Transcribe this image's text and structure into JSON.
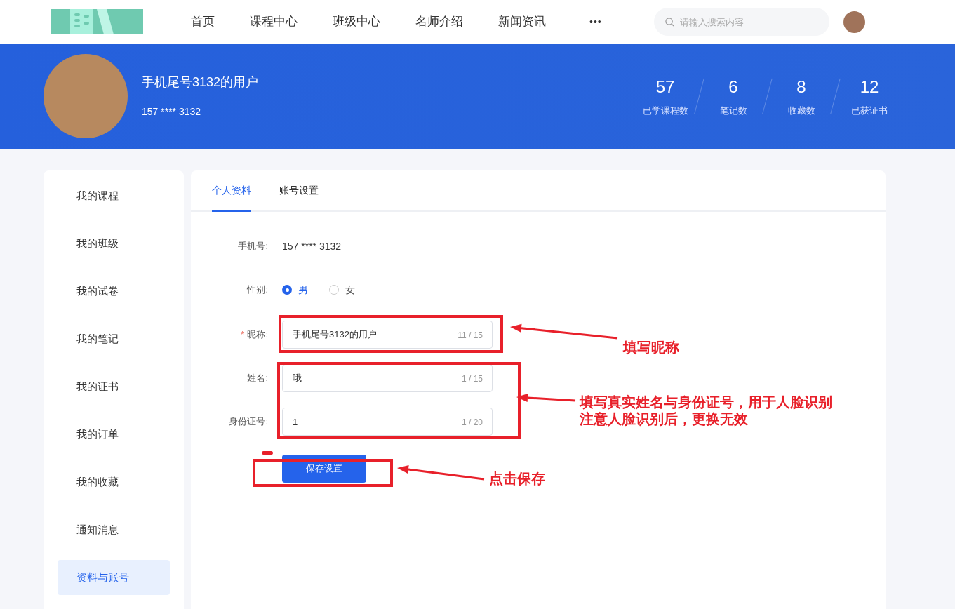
{
  "nav": {
    "items": [
      {
        "label": "首页",
        "selected": false
      },
      {
        "label": "课程中心",
        "selected": false
      },
      {
        "label": "班级中心",
        "selected": false
      },
      {
        "label": "名师介绍",
        "selected": false
      },
      {
        "label": "新闻资讯",
        "selected": false
      }
    ],
    "more": "•••",
    "search": {
      "placeholder": "请输入搜索内容"
    }
  },
  "profile": {
    "name": "手机尾号3132的用户",
    "phone": "157 **** 3132",
    "stats": [
      {
        "value": "57",
        "label": "已学课程数"
      },
      {
        "value": "6",
        "label": "笔记数"
      },
      {
        "value": "8",
        "label": "收藏数"
      },
      {
        "value": "12",
        "label": "已获证书"
      }
    ]
  },
  "sidebar": {
    "items": [
      {
        "label": "我的课程",
        "selected": false
      },
      {
        "label": "我的班级",
        "selected": false
      },
      {
        "label": "我的试卷",
        "selected": false
      },
      {
        "label": "我的笔记",
        "selected": false
      },
      {
        "label": "我的证书",
        "selected": false
      },
      {
        "label": "我的订单",
        "selected": false
      },
      {
        "label": "我的收藏",
        "selected": false
      },
      {
        "label": "通知消息",
        "selected": false
      },
      {
        "label": "资料与账号",
        "selected": true
      }
    ]
  },
  "tabs": [
    {
      "label": "个人资料",
      "selected": true
    },
    {
      "label": "账号设置",
      "selected": false
    }
  ],
  "form": {
    "phone_label": "手机号:",
    "phone": "157 **** 3132",
    "gender_label": "性别:",
    "genders": [
      {
        "label": "男",
        "selected": true
      },
      {
        "label": "女",
        "selected": false
      }
    ],
    "fields": [
      {
        "label": "昵称:",
        "required": true,
        "value": "手机尾号3132的用户",
        "count": "11 / 15"
      },
      {
        "label": "姓名:",
        "required": false,
        "value": "哦",
        "count": "1 / 15"
      },
      {
        "label": "身份证号:",
        "required": false,
        "value": "1",
        "count": "1 / 20"
      }
    ],
    "required_mark": "*",
    "save": "保存设置"
  },
  "annotations": [
    "填写昵称",
    "填写真实姓名与身份证号，用于人脸识别",
    "注意人脸识别后，更换无效",
    "点击保存"
  ]
}
